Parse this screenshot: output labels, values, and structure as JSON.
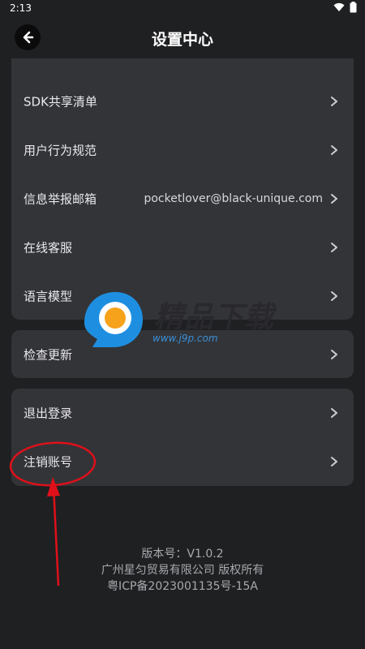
{
  "status_bar": {
    "time": "2:13"
  },
  "header": {
    "title": "设置中心",
    "back_icon": "chevron-left-icon"
  },
  "settings": {
    "group1": [
      {
        "label": "SDK共享清单"
      },
      {
        "label": "用户行为规范"
      },
      {
        "label": "信息举报邮箱",
        "value": "pocketlover@black-unique.com"
      },
      {
        "label": "在线客服"
      },
      {
        "label": "语言模型"
      }
    ],
    "group2": [
      {
        "label": "检查更新"
      }
    ],
    "group3": [
      {
        "label": "退出登录"
      },
      {
        "label": "注销账号"
      }
    ]
  },
  "footer": {
    "version": "版本号：V1.0.2",
    "company": "广州星匀贸易有限公司 版权所有",
    "icp": "粤ICP备2023001135号-15A"
  },
  "watermark": {
    "brand": "精品下载",
    "url": "www.j9p.com"
  },
  "colors": {
    "background": "#1f2022",
    "card": "#333438",
    "text": "#e9e9ec",
    "footer_text": "#a8a9ae",
    "annotation": "#e0101a",
    "watermark_blue": "#1e8fe0",
    "watermark_orange": "#f7a21b"
  }
}
